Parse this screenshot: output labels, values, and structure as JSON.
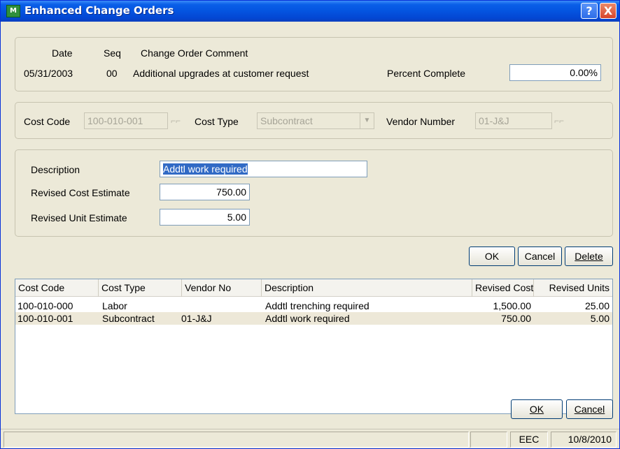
{
  "window": {
    "title": "Enhanced Change Orders",
    "app_icon_text": "M",
    "help_label": "?",
    "close_label": "X"
  },
  "header": {
    "date_label": "Date",
    "seq_label": "Seq",
    "comment_label": "Change Order Comment",
    "date_value": "05/31/2003",
    "seq_value": "00",
    "comment_value": "Additional upgrades at customer request",
    "percent_label": "Percent Complete",
    "percent_value": "0.00%"
  },
  "codes": {
    "cost_code_label": "Cost Code",
    "cost_code_value": "100-010-001",
    "cost_type_label": "Cost Type",
    "cost_type_value": "Subcontract",
    "vendor_label": "Vendor Number",
    "vendor_value": "01-J&J"
  },
  "detail": {
    "description_label": "Description",
    "description_value": "Addtl work required",
    "revised_cost_label": "Revised Cost Estimate",
    "revised_cost_value": "750.00",
    "revised_unit_label": "Revised Unit Estimate",
    "revised_unit_value": "5.00"
  },
  "line_buttons": {
    "ok": "OK",
    "cancel": "Cancel",
    "delete": "Delete"
  },
  "grid": {
    "columns": [
      "Cost Code",
      "Cost Type",
      "Vendor No",
      "Description",
      "Revised Cost",
      "Revised Units"
    ],
    "rows": [
      [
        "100-010-000",
        "Labor",
        "",
        "Addtl trenching required",
        "1,500.00",
        "25.00"
      ],
      [
        "100-010-001",
        "Subcontract",
        "01-J&J",
        "Addtl work required",
        "750.00",
        "5.00"
      ]
    ]
  },
  "footer_buttons": {
    "ok": "OK",
    "cancel": "Cancel"
  },
  "status": {
    "company": "EEC",
    "date": "10/8/2010"
  },
  "colors": {
    "title_bar": "#0454e0",
    "selection": "#316ac5",
    "window_bg": "#ece9d8"
  }
}
